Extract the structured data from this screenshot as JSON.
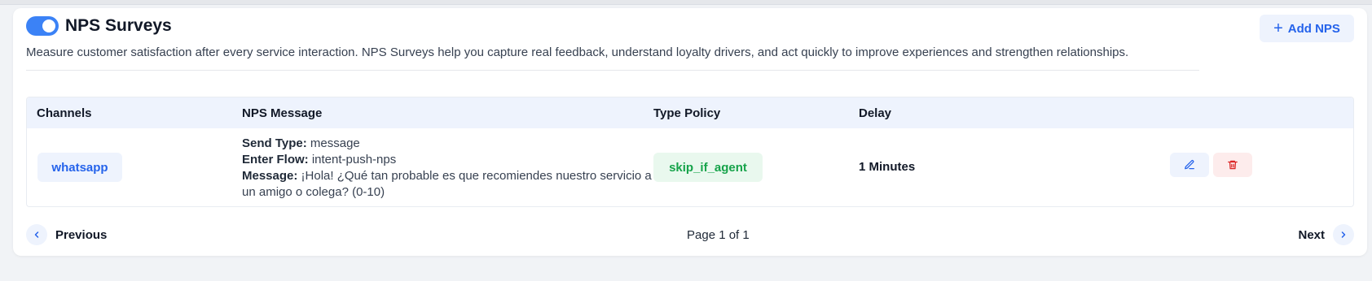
{
  "header": {
    "toggle_state": "on",
    "title": "NPS Surveys",
    "description": "Measure customer satisfaction after every service interaction. NPS Surveys help you capture real feedback, understand loyalty drivers, and act quickly to improve experiences and strengthen relationships.",
    "add_button_label": "Add NPS"
  },
  "table": {
    "columns": [
      "Channels",
      "NPS Message",
      "Type Policy",
      "Delay"
    ],
    "rows": [
      {
        "channel": "whatsapp",
        "send_type_label": "Send Type:",
        "send_type_value": "message",
        "enter_flow_label": "Enter Flow:",
        "enter_flow_value": "intent-push-nps",
        "message_label": "Message:",
        "message_value": "¡Hola! ¿Qué tan probable es que recomiendes nuestro servicio a un amigo o colega? (0-10)",
        "type_policy": "skip_if_agent",
        "delay": "1 Minutes"
      }
    ]
  },
  "pagination": {
    "previous_label": "Previous",
    "page_info": "Page 1 of 1",
    "next_label": "Next"
  },
  "colors": {
    "accent": "#3b82f6",
    "link_blue": "#2563eb",
    "policy_green": "#16a34a",
    "danger_red": "#dc2626"
  },
  "icons": {
    "add": "plus-icon",
    "edit": "edit-icon",
    "delete": "trash-icon",
    "previous": "chevron-left-icon",
    "next": "chevron-right-icon"
  }
}
